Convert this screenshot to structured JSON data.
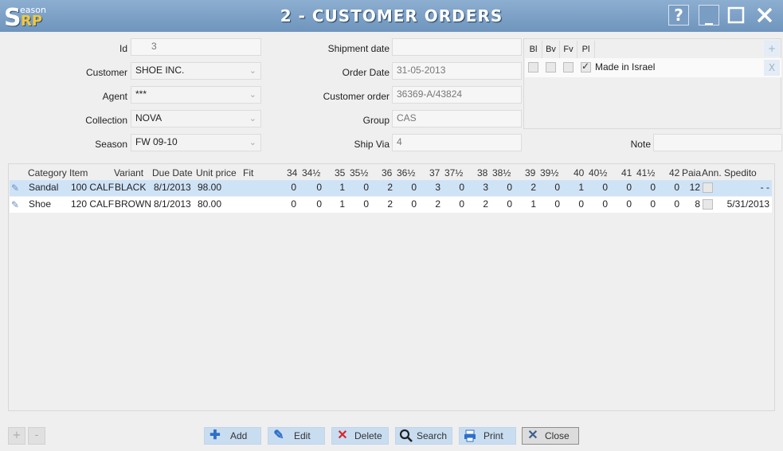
{
  "window": {
    "title": "2 - CUSTOMER ORDERS",
    "logo_s": "S",
    "logo_eason": "eason",
    "logo_rp": "RP",
    "help": "?",
    "minimize": "_",
    "maximize": "☐",
    "close": "✕"
  },
  "form": {
    "id_label": "Id",
    "id_value": "3",
    "customer_label": "Customer",
    "customer_value": "SHOE INC.",
    "agent_label": "Agent",
    "agent_value": "***",
    "collection_label": "Collection",
    "collection_value": "NOVA",
    "season_label": "Season",
    "season_value": "FW 09-10",
    "shipment_label": "Shipment date",
    "shipment_value": "",
    "orderdate_label": "Order Date",
    "orderdate_value": "31-05-2013",
    "custorder_label": "Customer order",
    "custorder_value": "36369-A/43824",
    "group_label": "Group",
    "group_value": "CAS",
    "shipvia_label": "Ship Via",
    "shipvia_value": "4",
    "note_label": "Note",
    "note_value": ""
  },
  "tags": {
    "columns": [
      "Bl",
      "Bv",
      "Fv",
      "Pl"
    ],
    "add": "+",
    "remove": "X",
    "rows": [
      {
        "checks": [
          false,
          false,
          false,
          true
        ],
        "text": "Made in Israel"
      }
    ]
  },
  "grid": {
    "headers": [
      "Category",
      "Item",
      "Variant",
      "Due Date",
      "Unit price",
      "Fit",
      "34",
      "34½",
      "35",
      "35½",
      "36",
      "36½",
      "37",
      "37½",
      "38",
      "38½",
      "39",
      "39½",
      "40",
      "40½",
      "41",
      "41½",
      "42",
      "Paia",
      "Ann.",
      "Spedito"
    ],
    "rows": [
      {
        "category": "Sandal",
        "item": "100 CALF",
        "variant": "BLACK",
        "due": "8/1/2013",
        "price": "98.00",
        "fit": "",
        "sizes": [
          "0",
          "0",
          "1",
          "0",
          "2",
          "0",
          "3",
          "0",
          "3",
          "0",
          "2",
          "0",
          "1",
          "0",
          "0",
          "0",
          "0"
        ],
        "paia": "12",
        "spedito": "-  -"
      },
      {
        "category": "Shoe",
        "item": "120 CALF",
        "variant": "BROWN",
        "due": "8/1/2013",
        "price": "80.00",
        "fit": "",
        "sizes": [
          "0",
          "0",
          "1",
          "0",
          "2",
          "0",
          "2",
          "0",
          "2",
          "0",
          "1",
          "0",
          "0",
          "0",
          "0",
          "0",
          "0"
        ],
        "paia": "8",
        "spedito": "5/31/2013"
      }
    ]
  },
  "buttons": {
    "plus": "+",
    "minus": "-",
    "add": "Add",
    "edit": "Edit",
    "delete": "Delete",
    "search": "Search",
    "print": "Print",
    "close": "Close"
  },
  "icons": {
    "add": "plus-icon",
    "edit": "pencil-icon",
    "delete": "x-icon",
    "search": "magnifier-icon",
    "print": "printer-icon",
    "close": "x-icon"
  },
  "colors": {
    "titlebar": "#7c9fc6",
    "row_selected": "#cfe3f7",
    "add_icon": "#2d6fc7",
    "delete_icon": "#d9262a"
  }
}
